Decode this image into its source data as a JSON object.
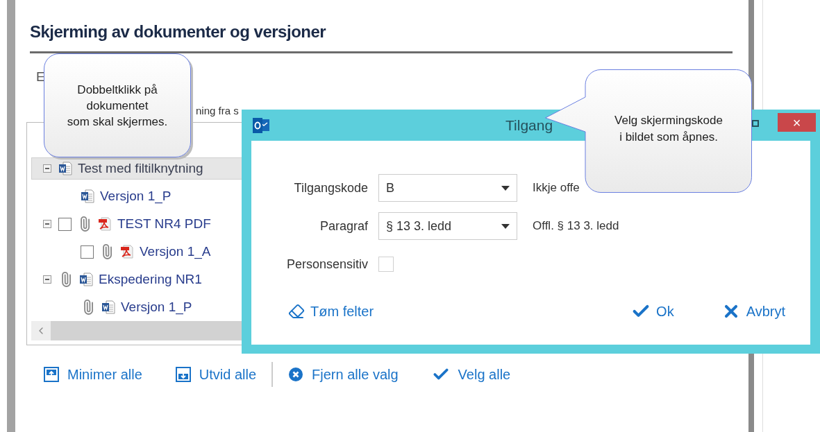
{
  "page": {
    "title": "Skjerming av dokumenter og versjoner",
    "partial_texts": [
      "E",
      "ning fra s"
    ]
  },
  "tree": {
    "items": [
      {
        "label": "Test med filtilknytning",
        "kind": "word",
        "attached": false,
        "selected": true,
        "expanded": true,
        "children": [
          {
            "label": "Versjon 1_P",
            "kind": "word",
            "attached": false,
            "selected": false
          }
        ]
      },
      {
        "label": "TEST NR4 PDF",
        "kind": "pdf",
        "checked": false,
        "attached": true,
        "selected": false,
        "expanded": true,
        "children": [
          {
            "label": "Versjon 1_A",
            "kind": "pdf",
            "checked": false,
            "attached": true,
            "selected": false
          }
        ]
      },
      {
        "label": "Ekspedering NR1",
        "kind": "word",
        "attached": true,
        "selected": false,
        "expanded": true,
        "children": [
          {
            "label": "Versjon 1_P",
            "kind": "word",
            "attached": true,
            "selected": false
          }
        ]
      }
    ]
  },
  "toolbar": {
    "groups": [
      [
        {
          "kind": "collapse",
          "label": "Minimer alle"
        },
        {
          "kind": "expand",
          "label": "Utvid alle"
        }
      ],
      [
        {
          "kind": "clear",
          "label": "Fjern alle valg"
        },
        {
          "kind": "check",
          "label": "Velg alle"
        }
      ]
    ]
  },
  "dialog": {
    "title": "Tilgang",
    "close": "×",
    "fields": [
      {
        "kind": "select",
        "label": "Tilgangskode",
        "value": "B",
        "description": "Ikkje offe"
      },
      {
        "kind": "select",
        "label": "Paragraf",
        "value": "§ 13 3. ledd",
        "description": "Offl. § 13 3. ledd"
      },
      {
        "kind": "checkbox",
        "label": "Personsensitiv",
        "checked": false
      }
    ],
    "buttons": [
      {
        "kind": "clear",
        "label": "Tøm felter"
      },
      {
        "kind": "ok",
        "label": "Ok"
      },
      {
        "kind": "cancel",
        "label": "Avbryt"
      }
    ]
  },
  "callouts": [
    {
      "text": "Dobbeltklikk på\ndokumentet\nsom skal skjermes."
    },
    {
      "text": "Velg skjermingskode\ni bildet som åpnes."
    }
  ]
}
